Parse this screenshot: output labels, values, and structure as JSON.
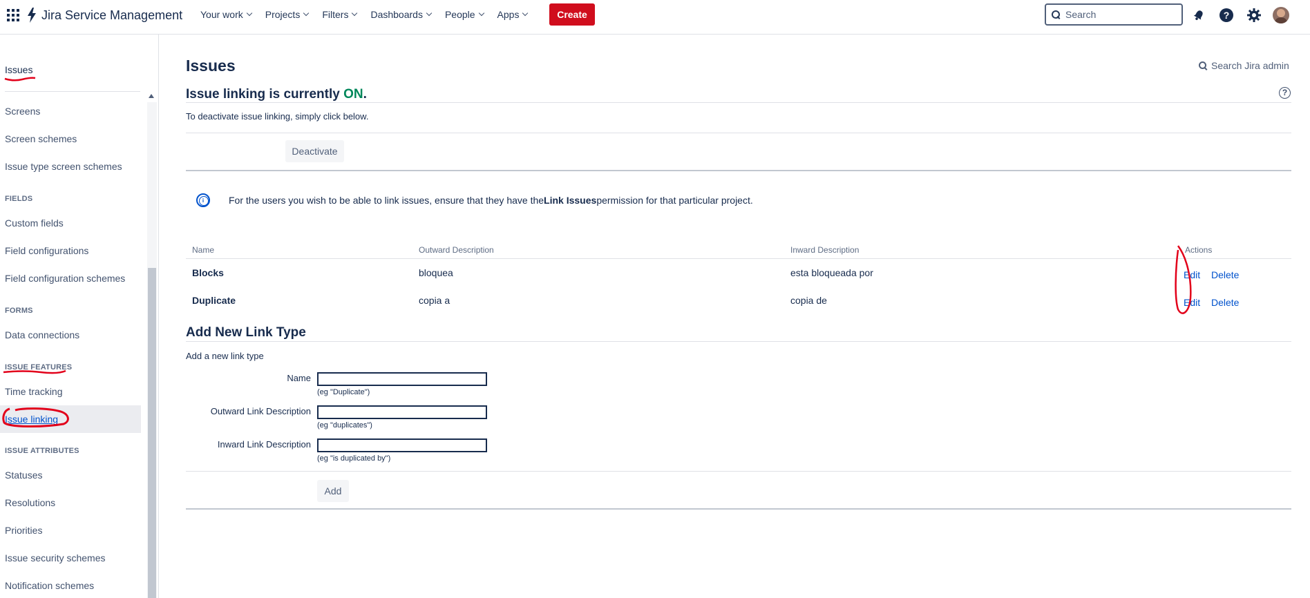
{
  "topnav": {
    "product": "Jira Service Management",
    "items": [
      {
        "label": "Your work"
      },
      {
        "label": "Projects"
      },
      {
        "label": "Filters"
      },
      {
        "label": "Dashboards"
      },
      {
        "label": "People"
      },
      {
        "label": "Apps"
      }
    ],
    "create_label": "Create",
    "search_placeholder": "Search",
    "icons": [
      "notifications-icon",
      "help-icon",
      "settings-icon",
      "avatar"
    ]
  },
  "sidebar": {
    "top_item": "Issues",
    "items": [
      {
        "label": "Screens",
        "type": "item"
      },
      {
        "label": "Screen schemes",
        "type": "item"
      },
      {
        "label": "Issue type screen schemes",
        "type": "item"
      },
      {
        "label": "FIELDS",
        "type": "heading"
      },
      {
        "label": "Custom fields",
        "type": "item"
      },
      {
        "label": "Field configurations",
        "type": "item"
      },
      {
        "label": "Field configuration schemes",
        "type": "item"
      },
      {
        "label": "FORMS",
        "type": "heading"
      },
      {
        "label": "Data connections",
        "type": "item"
      },
      {
        "label": "ISSUE FEATURES",
        "type": "heading"
      },
      {
        "label": "Time tracking",
        "type": "item"
      },
      {
        "label": "Issue linking",
        "type": "item",
        "active": true
      },
      {
        "label": "ISSUE ATTRIBUTES",
        "type": "heading"
      },
      {
        "label": "Statuses",
        "type": "item"
      },
      {
        "label": "Resolutions",
        "type": "item"
      },
      {
        "label": "Priorities",
        "type": "item"
      },
      {
        "label": "Issue security schemes",
        "type": "item"
      },
      {
        "label": "Notification schemes",
        "type": "item"
      }
    ]
  },
  "main": {
    "page_title": "Issues",
    "admin_search": "Search Jira admin",
    "status_prefix": "Issue linking is currently ",
    "status_value": "ON",
    "status_suffix": ".",
    "deactivate_desc": "To deactivate issue linking, simply click below.",
    "deactivate_label": "Deactivate",
    "info_prefix": "For the users you wish to be able to link issues, ensure that they have the ",
    "info_bold": "Link Issues",
    "info_suffix": " permission for that particular project.",
    "table": {
      "columns": [
        "Name",
        "Outward Description",
        "Inward Description",
        "Actions"
      ],
      "rows": [
        {
          "name": "Blocks",
          "outward": "bloquea",
          "inward": "esta bloqueada por",
          "edit": "Edit",
          "delete": "Delete"
        },
        {
          "name": "Duplicate",
          "outward": "copia a",
          "inward": "copia de",
          "edit": "Edit",
          "delete": "Delete"
        }
      ]
    },
    "add_form": {
      "title": "Add New Link Type",
      "subtitle": "Add a new link type",
      "fields": [
        {
          "label": "Name",
          "hint": "(eg \"Duplicate\")"
        },
        {
          "label": "Outward Link Description",
          "hint": "(eg \"duplicates\")"
        },
        {
          "label": "Inward Link Description",
          "hint": "(eg \"is duplicated by\")"
        }
      ],
      "submit_label": "Add"
    },
    "colors": {
      "on": "#00875a",
      "link": "#0052cc",
      "create": "#d00d1d",
      "annotation": "#e2001a"
    }
  }
}
